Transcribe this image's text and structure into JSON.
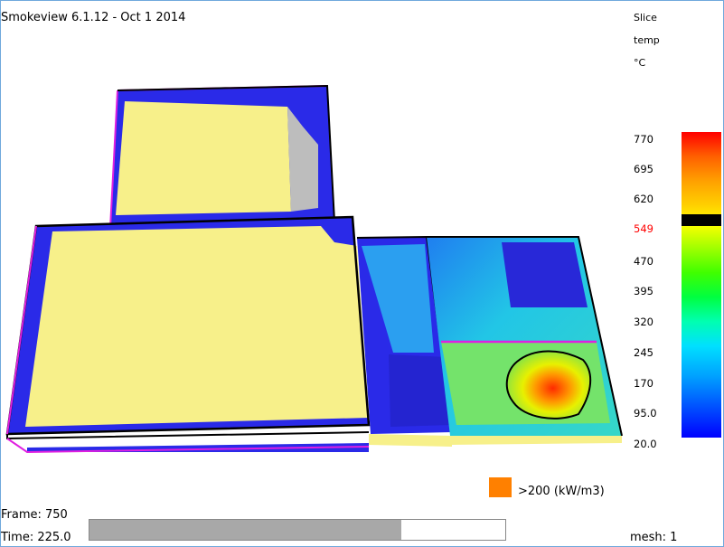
{
  "window": {
    "title": "Smokeview 6.1.12 - Oct  1 2014"
  },
  "colorbar": {
    "header": [
      "Slice",
      "temp",
      "°C"
    ],
    "labels": [
      "770",
      "695",
      "620",
      "549",
      "470",
      "395",
      "320",
      "245",
      "170",
      "95.0",
      "20.0"
    ],
    "highlighted_label": "549",
    "colors": {
      "highlight": "#ff0000",
      "marker": "#000000"
    }
  },
  "legend": {
    "text": ">200 (kW/m3)",
    "color": "#ff8000"
  },
  "status": {
    "frame_text": "Frame: 750",
    "time_text": "Time: 225.0",
    "mesh_text": "mesh: 1",
    "time_progress_fraction": 0.75
  },
  "scene_colors": {
    "walls": "#f7f08a",
    "floor_blue": "#2a2ae8",
    "grey": "#bdbdbd",
    "outline": "#000000",
    "mesh_edge": "#e020e0"
  }
}
